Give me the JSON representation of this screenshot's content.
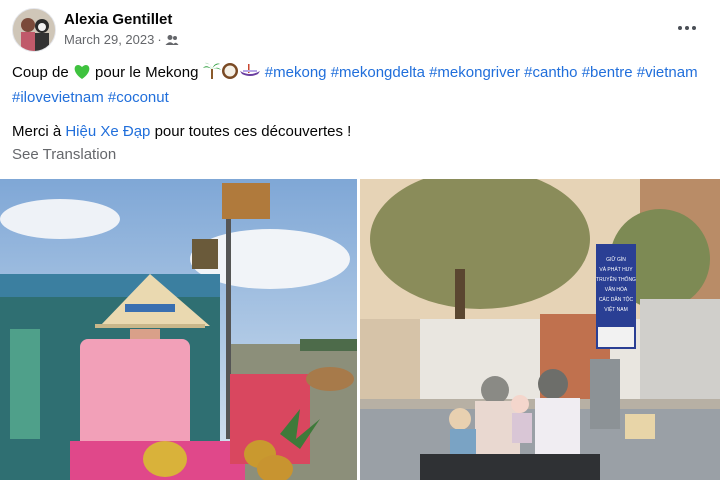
{
  "post": {
    "author": "Alexia Gentillet",
    "date": "March 29, 2023",
    "separator": "·",
    "privacy_icon": "friends-icon",
    "text_prefix": "Coup de ",
    "text_middle": " pour le Mekong ",
    "hashtags": [
      "#mekong",
      "#mekongdelta",
      "#mekongriver",
      "#cantho",
      "#bentre",
      "#vietnam",
      "#ilovevietnam",
      "#coconut"
    ],
    "line2_prefix": "Merci à ",
    "line2_mention": "Hiệu Xe Đạp",
    "line2_suffix": " pour toutes ces découvertes !",
    "see_translation": "See Translation"
  },
  "icons": {
    "heart": "green-heart-icon",
    "palm": "palm-tree-icon",
    "coconut": "coconut-icon",
    "boat": "canoe-icon",
    "more": "more-options-icon"
  },
  "photos": {
    "left": "photo-market-vendor",
    "right": "photo-street-scooter",
    "sign_lines": [
      "GIỮ GÌN",
      "VÀ PHÁT HUY",
      "TRUYỀN THỐNG",
      "VĂN HÓA",
      "CÁC DÂN TỘC",
      "VIỆT NAM"
    ]
  },
  "colors": {
    "hashtag": "#216fdb",
    "meta": "#65676b",
    "heart": "#3fc23f"
  }
}
